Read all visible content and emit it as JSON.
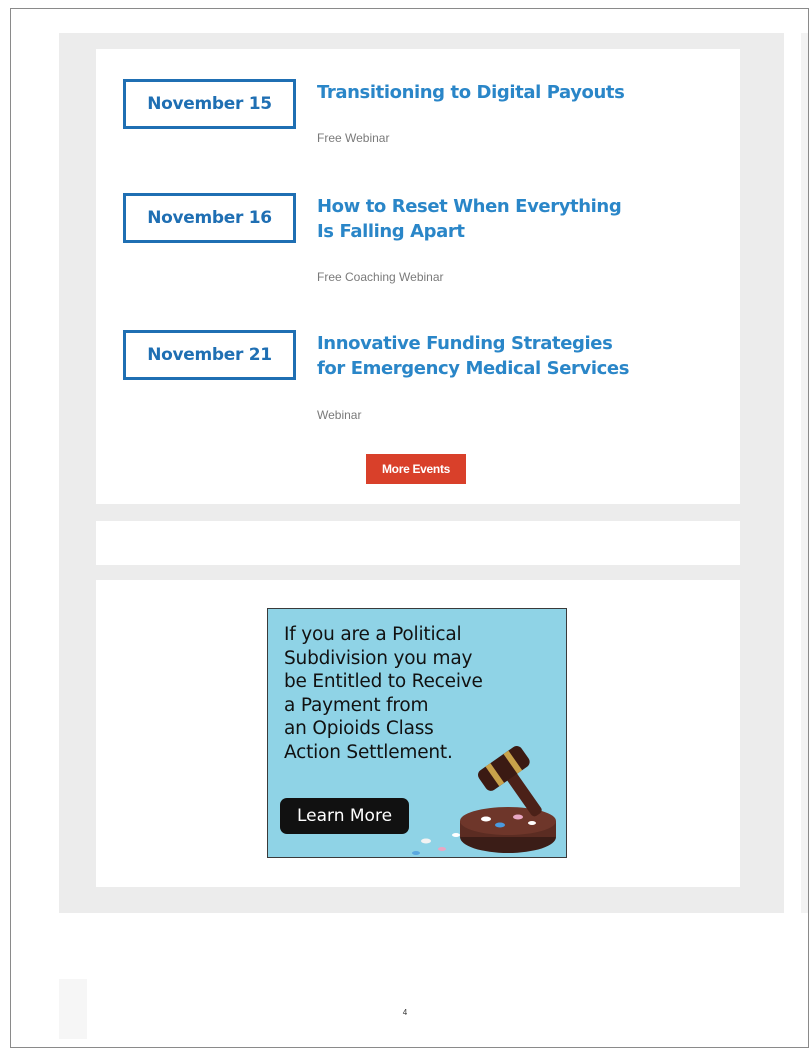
{
  "events": [
    {
      "date": "November 15",
      "title": "Transitioning to Digital Payouts",
      "type": "Free Webinar"
    },
    {
      "date": "November 16",
      "title": "How to Reset When Everything Is Falling Apart",
      "type": "Free Coaching Webinar"
    },
    {
      "date": "November 21",
      "title": "Innovative Funding Strategies for Emergency Medical Services",
      "type": "Webinar"
    }
  ],
  "more_events_label": "More Events",
  "ad": {
    "lines": [
      "If you are a Political",
      "Subdivision you may",
      "be Entitled to Receive",
      "a Payment from",
      "an Opioids Class",
      "Action Settlement."
    ],
    "button_label": "Learn More",
    "art_icon": "gavel-icon",
    "background_color": "#8fd3e6"
  },
  "page_number": "4",
  "colors": {
    "date_border": "#1f6fb3",
    "title": "#2a86c8",
    "button": "#d9402a"
  }
}
